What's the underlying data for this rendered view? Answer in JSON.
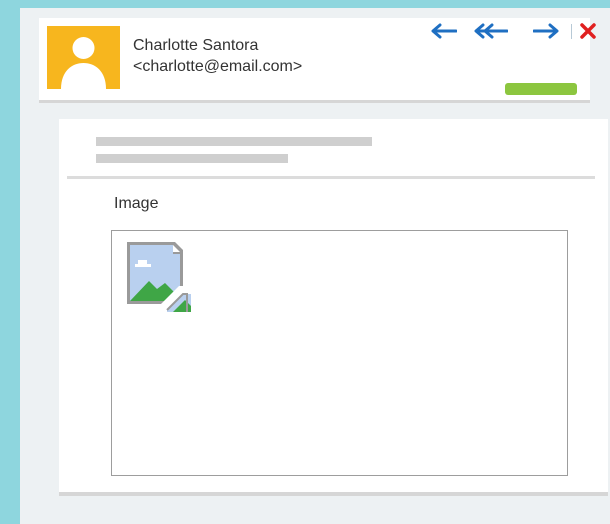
{
  "sender": {
    "name": "Charlotte Santora",
    "email": "<charlotte@email.com>"
  },
  "toolbar": {
    "reply_icon": "arrow-left-icon",
    "reply_all_icon": "double-arrow-left-icon",
    "forward_icon": "arrow-right-icon",
    "close_icon": "close-icon"
  },
  "content": {
    "image_label": "Image",
    "image_icon": "broken-image-icon"
  },
  "colors": {
    "background": "#8ed6de",
    "window": "#edf1f3",
    "avatar": "#f7b61e",
    "arrow": "#1f6fc2",
    "close": "#e02020",
    "action": "#8cc63f"
  }
}
